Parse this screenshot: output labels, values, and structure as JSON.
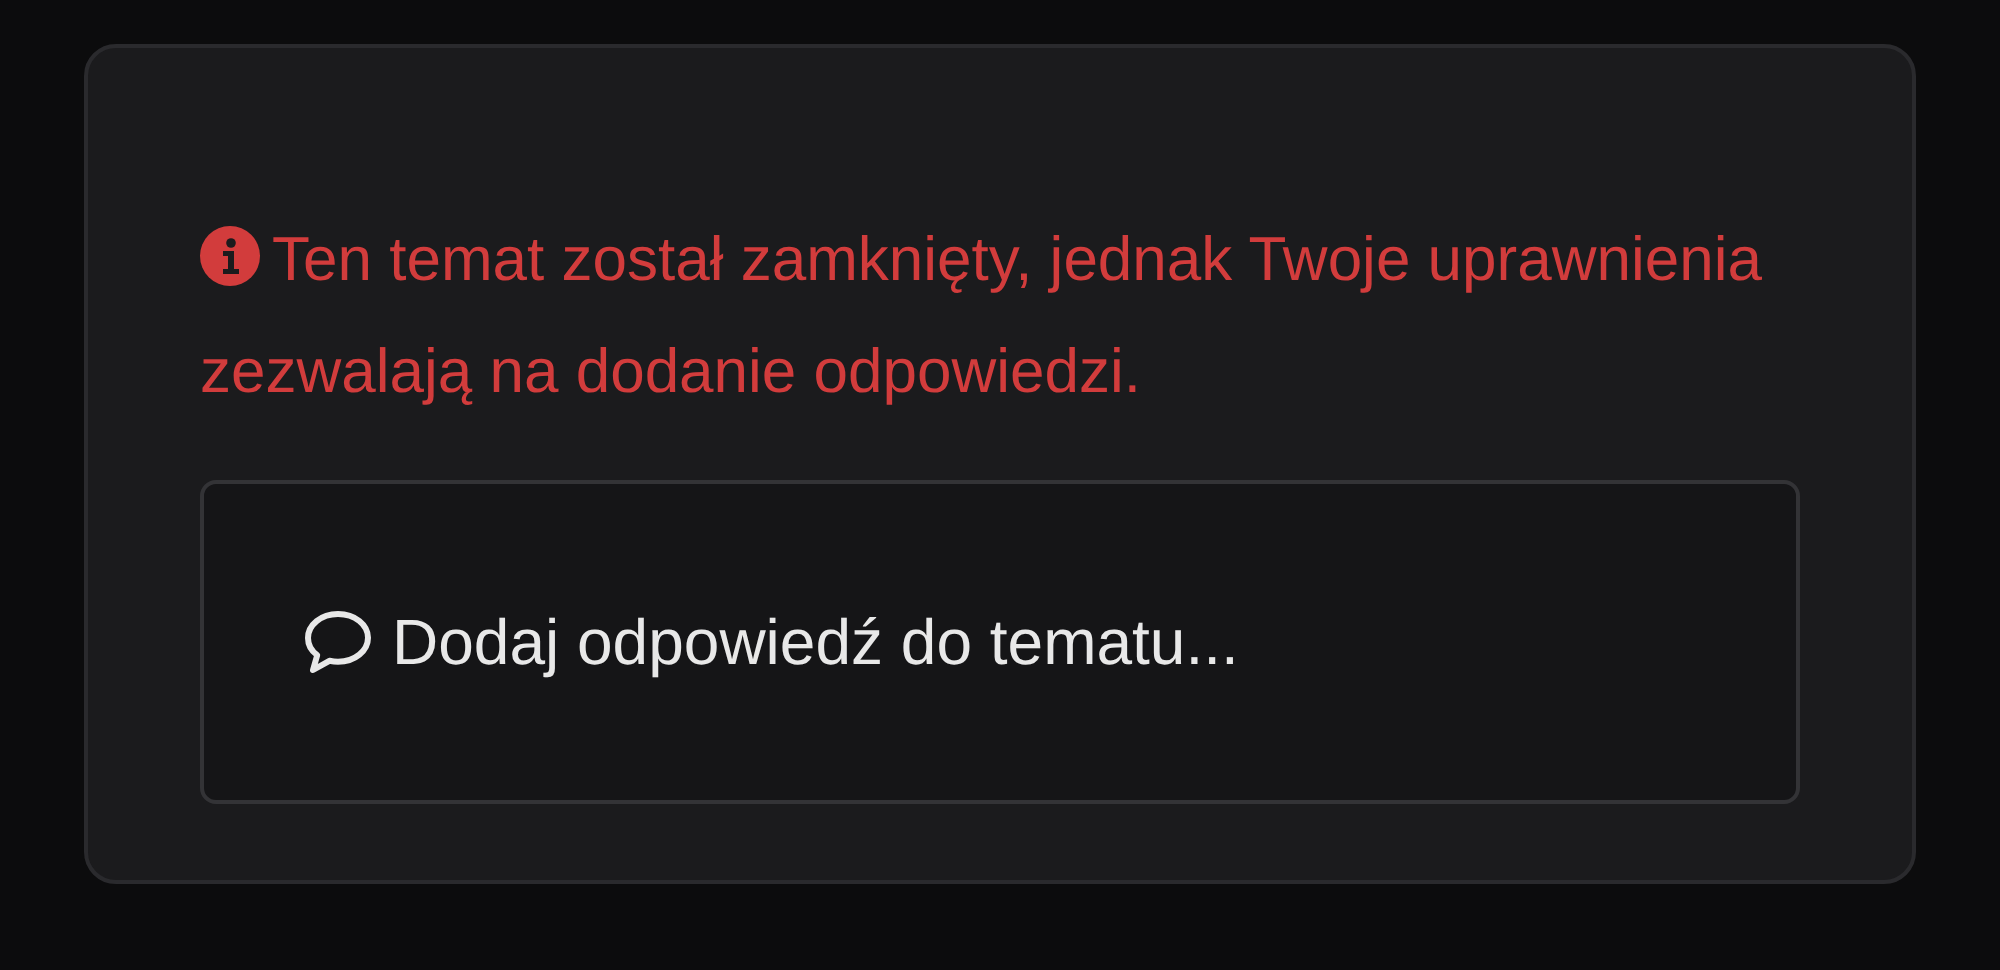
{
  "notice": {
    "text": "Ten temat został zamknięty, jednak Twoje uprawnienia zezwalają na dodanie odpowiedzi."
  },
  "reply_button": {
    "label": "Dodaj odpowiedź do tematu..."
  }
}
